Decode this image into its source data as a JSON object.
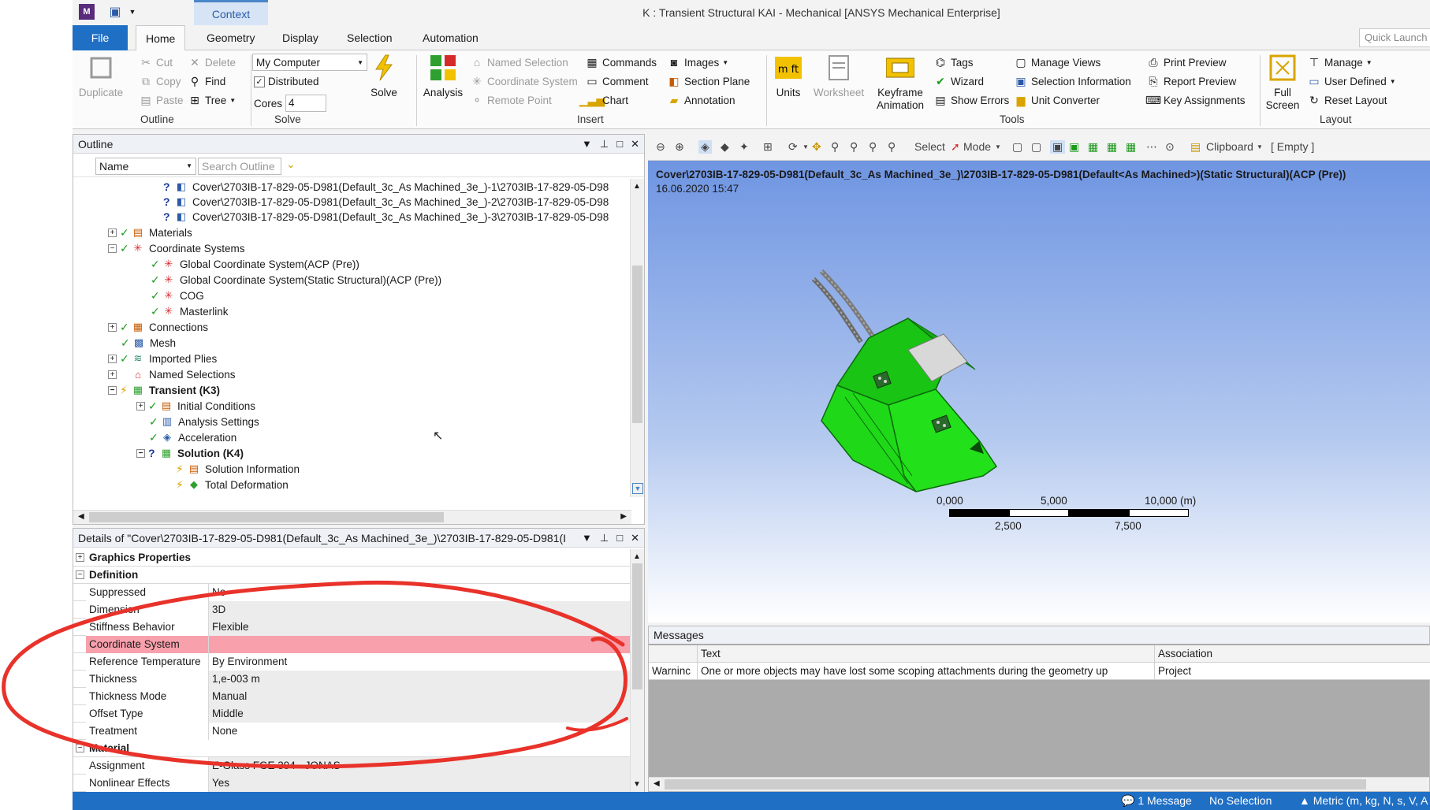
{
  "titlebar": {
    "window_title": "K : Transient Structural KAI - Mechanical [ANSYS Mechanical Enterprise]",
    "context_tab": "Context",
    "logo": "M"
  },
  "ribbon_tabs": [
    "File",
    "Home",
    "Geometry",
    "Display",
    "Selection",
    "Automation"
  ],
  "quick_launch_placeholder": "Quick Launch",
  "ribbon": {
    "outline": {
      "duplicate": "Duplicate",
      "cut": "Cut",
      "copy": "Copy",
      "paste": "Paste",
      "delete": "Delete",
      "find": "Find",
      "tree": "Tree",
      "label": "Outline"
    },
    "solve": {
      "computer": "My Computer",
      "distributed": "Distributed",
      "cores_label": "Cores",
      "cores_value": "4",
      "solve_btn": "Solve",
      "label": "Solve"
    },
    "insert": {
      "analysis": "Analysis",
      "named_selection": "Named Selection",
      "coordinate_system": "Coordinate System",
      "remote_point": "Remote Point",
      "commands": "Commands",
      "comment": "Comment",
      "chart": "Chart",
      "images": "Images",
      "section_plane": "Section Plane",
      "annotation": "Annotation",
      "label": "Insert"
    },
    "tools": {
      "units": "Units",
      "worksheet": "Worksheet",
      "keyframe": "Keyframe",
      "animation": "Animation",
      "tags": "Tags",
      "wizard": "Wizard",
      "show_errors": "Show Errors",
      "manage_views": "Manage Views",
      "selection_info": "Selection Information",
      "unit_converter": "Unit Converter",
      "print_preview": "Print Preview",
      "report_preview": "Report Preview",
      "key_assignments": "Key Assignments",
      "label": "Tools"
    },
    "layout": {
      "full": "Full",
      "screen": "Screen",
      "manage": "Manage",
      "user_defined": "User Defined",
      "reset_layout": "Reset Layout",
      "label": "Layout"
    }
  },
  "outline": {
    "title": "Outline",
    "filter_select": "Name",
    "search_placeholder": "Search Outline",
    "nodes": [
      "Cover\\2703IB-17-829-05-D981(Default_3c_As Machined_3e_)-1\\2703IB-17-829-05-D98",
      "Cover\\2703IB-17-829-05-D981(Default_3c_As Machined_3e_)-2\\2703IB-17-829-05-D98",
      "Cover\\2703IB-17-829-05-D981(Default_3c_As Machined_3e_)-3\\2703IB-17-829-05-D98",
      "Materials",
      "Coordinate Systems",
      "Global Coordinate System(ACP (Pre))",
      "Global Coordinate System(Static Structural)(ACP (Pre))",
      "COG",
      "Masterlink",
      "Connections",
      "Mesh",
      "Imported Plies",
      "Named Selections",
      "Transient (K3)",
      "Initial Conditions",
      "Analysis Settings",
      "Acceleration",
      "Solution (K4)",
      "Solution Information",
      "Total Deformation"
    ]
  },
  "details": {
    "title": "Details of \"Cover\\2703IB-17-829-05-D981(Default_3c_As Machined_3e_)\\2703IB-17-829-05-D981(I",
    "groups": {
      "graphics": "Graphics Properties",
      "definition": "Definition",
      "material": "Material"
    },
    "rows": [
      {
        "key": "Suppressed",
        "value": "No"
      },
      {
        "key": "Dimension",
        "value": "3D"
      },
      {
        "key": "Stiffness Behavior",
        "value": "Flexible"
      },
      {
        "key": "Coordinate System",
        "value": ""
      },
      {
        "key": "Reference Temperature",
        "value": "By Environment"
      },
      {
        "key": "Thickness",
        "value": "1,e-003 m"
      },
      {
        "key": "Thickness Mode",
        "value": "Manual"
      },
      {
        "key": "Offset Type",
        "value": "Middle"
      },
      {
        "key": "Treatment",
        "value": "None"
      },
      {
        "key": "Assignment",
        "value": "E-Glass FGE 394 - JONAS"
      },
      {
        "key": "Nonlinear Effects",
        "value": "Yes"
      }
    ]
  },
  "viewport": {
    "toolbar": {
      "select": "Select",
      "mode": "Mode",
      "clipboard": "Clipboard",
      "empty": "[ Empty ]"
    },
    "caption": "Cover\\2703IB-17-829-05-D981(Default_3c_As Machined_3e_)\\2703IB-17-829-05-D981(Default<As Machined>)(Static Structural)(ACP (Pre))",
    "date": "16.06.2020 15:47",
    "scale": {
      "t0": "0,000",
      "t1": "5,000",
      "t2": "10,000 (m)",
      "b1": "2,500",
      "b2": "7,500"
    },
    "model_color": "#22e11a"
  },
  "messages": {
    "title": "Messages",
    "col_text": "Text",
    "col_association": "Association",
    "row": {
      "type": "Warninc",
      "text": "One or more objects may have lost some scoping attachments during the geometry up",
      "association": "Project"
    }
  },
  "statusbar": {
    "messages": "1 Message",
    "selection": "No Selection",
    "units": "Metric (m, kg, N, s, V, A"
  },
  "colors": {
    "accent": "#1f6fc5",
    "highlight_row": "#f8a0ac",
    "annotation": "#e8322a"
  }
}
